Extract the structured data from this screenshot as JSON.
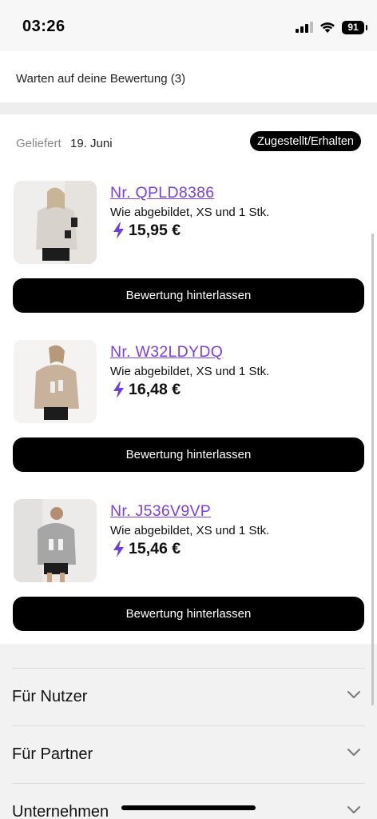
{
  "status_bar": {
    "time": "03:26",
    "battery": "91"
  },
  "pending": {
    "text": "Warten auf deine Bewertung (3)"
  },
  "order": {
    "delivered_label": "Geliefert",
    "delivered_date": "19. Juni",
    "status": "Zugestellt/Erhalten",
    "items": [
      {
        "order_no": "Nr. QPLD8386",
        "variant": "Wie abgebildet, XS und 1 Stk.",
        "price": "15,95 €",
        "button": "Bewertung hinterlassen"
      },
      {
        "order_no": "Nr. W32LDYDQ",
        "variant": "Wie abgebildet, XS und 1 Stk.",
        "price": "16,48 €",
        "button": "Bewertung hinterlassen"
      },
      {
        "order_no": "Nr. J536V9VP",
        "variant": "Wie abgebildet, XS und 1 Stk.",
        "price": "15,46 €",
        "button": "Bewertung hinterlassen"
      }
    ]
  },
  "footer": {
    "sections": [
      {
        "label": "Für Nutzer"
      },
      {
        "label": "Für Partner"
      },
      {
        "label": "Unternehmen"
      }
    ]
  },
  "colors": {
    "accent": "#7d3fe6",
    "lightning": "#6d3fe0",
    "button": "#000000"
  },
  "icons": {
    "signal": "cellular-signal-icon",
    "wifi": "wifi-icon",
    "battery": "battery-icon",
    "price": "lightning-icon",
    "accordion": "chevron-down-icon"
  }
}
